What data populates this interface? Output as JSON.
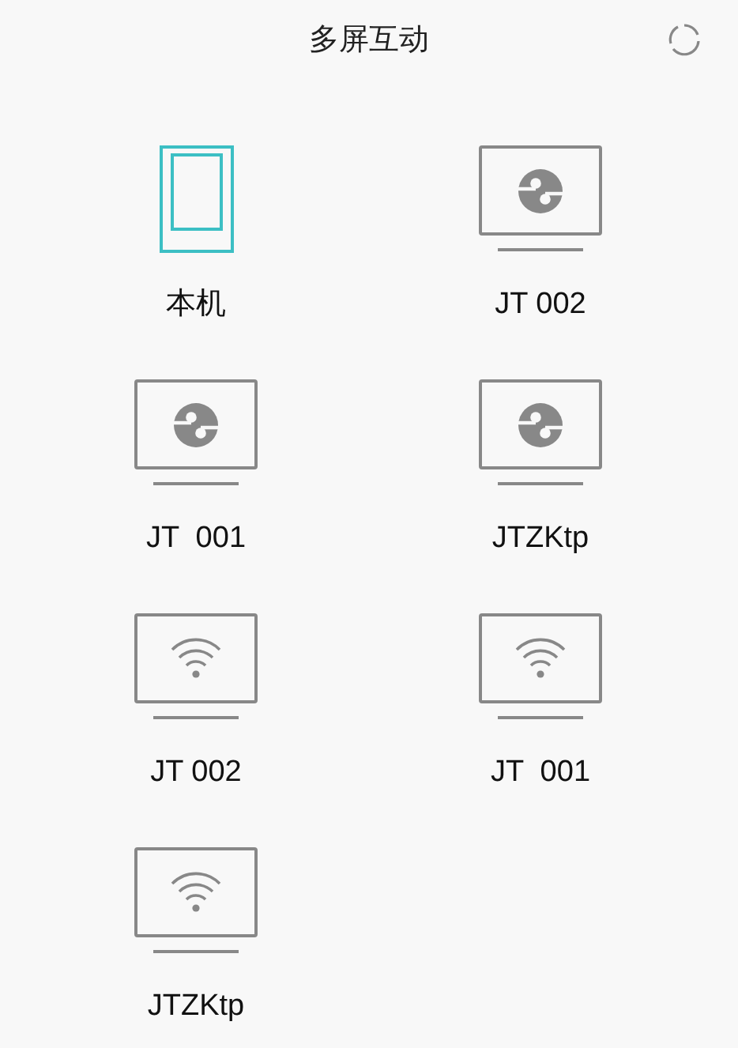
{
  "header": {
    "title": "多屏互动"
  },
  "devices": [
    {
      "name": "本机",
      "kind": "phone"
    },
    {
      "name": "JT 002",
      "kind": "cast"
    },
    {
      "name": "JT  001",
      "kind": "cast"
    },
    {
      "name": "JTZKtp",
      "kind": "cast"
    },
    {
      "name": "JT 002",
      "kind": "wifi"
    },
    {
      "name": "JT  001",
      "kind": "wifi"
    },
    {
      "name": "JTZKtp",
      "kind": "wifi"
    }
  ]
}
